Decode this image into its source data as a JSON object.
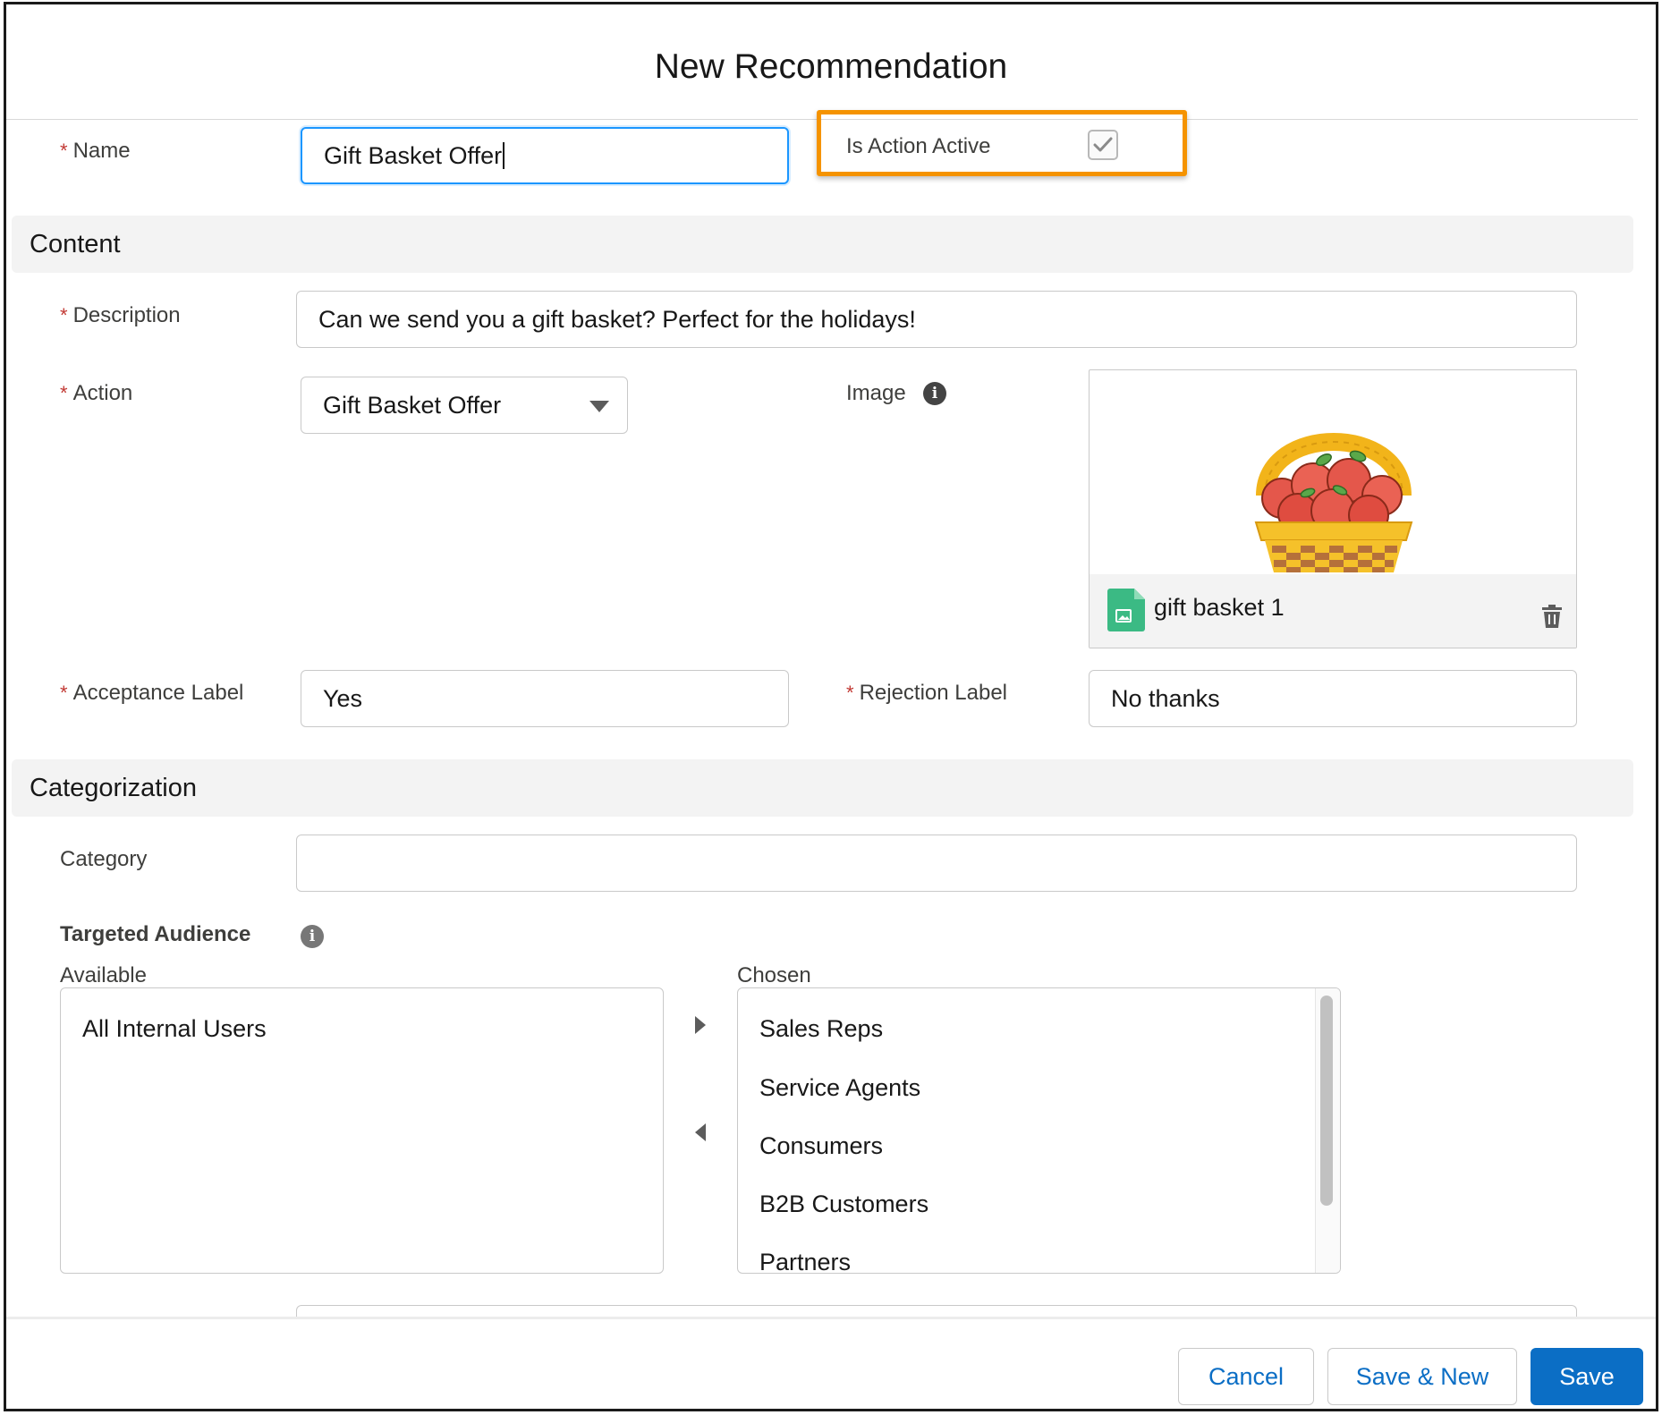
{
  "modal": {
    "title": "New Recommendation"
  },
  "name_field": {
    "label": "Name",
    "value": "Gift Basket Offer"
  },
  "is_action_active": {
    "label": "Is Action Active",
    "checked": true
  },
  "sections": {
    "content": "Content",
    "categorization": "Categorization"
  },
  "description_field": {
    "label": "Description",
    "value": "Can we send you a gift basket? Perfect for the holidays!"
  },
  "action_field": {
    "label": "Action",
    "value": "Gift Basket Offer"
  },
  "image_field": {
    "label": "Image",
    "file_name": "gift basket 1"
  },
  "acceptance_label_field": {
    "label": "Acceptance Label",
    "value": "Yes"
  },
  "rejection_label_field": {
    "label": "Rejection Label",
    "value": "No thanks"
  },
  "category_field": {
    "label": "Category",
    "value": ""
  },
  "targeted_audience": {
    "label": "Targeted Audience",
    "available_label": "Available",
    "chosen_label": "Chosen",
    "available": [
      "All Internal Users"
    ],
    "chosen": [
      "Sales Reps",
      "Service Agents",
      "Consumers",
      "B2B Customers",
      "Partners"
    ]
  },
  "footer": {
    "cancel": "Cancel",
    "save_new": "Save & New",
    "save": "Save"
  },
  "colors": {
    "brand": "#0b6ec5",
    "highlight": "#f59300",
    "required": "#c23934",
    "focus": "#1b96ff"
  }
}
